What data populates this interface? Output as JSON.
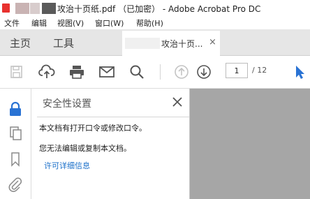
{
  "window": {
    "title": "攻治十页纸.pdf （已加密） - Adobe Acrobat Pro DC"
  },
  "menu": {
    "items": [
      "文件",
      "编辑",
      "视图(V)",
      "窗口(W)",
      "帮助(H)"
    ]
  },
  "tabs": {
    "home": "主页",
    "tools": "工具",
    "document": "攻治十页...",
    "close_glyph": "×"
  },
  "toolbar": {
    "icons": [
      "save-icon",
      "upload-icon",
      "print-icon",
      "mail-icon",
      "search-icon",
      "page-up-icon",
      "page-down-icon",
      "select-cursor-icon"
    ],
    "page_current": "1",
    "page_total": "/ 12"
  },
  "rail": {
    "icons": [
      "lock-icon",
      "pages-icon",
      "bookmark-icon",
      "attachment-icon"
    ]
  },
  "panel": {
    "title": "安全性设置",
    "line1": "本文档有打开口令或修改口令。",
    "line2": "您无法编辑或复制本文档。",
    "link": "许可详细信息"
  },
  "colors": {
    "accent": "#2a73d4",
    "link": "#1a6fc9",
    "document_bg": "#a6a6a6",
    "tabbar_bg": "#e6e6e6"
  }
}
